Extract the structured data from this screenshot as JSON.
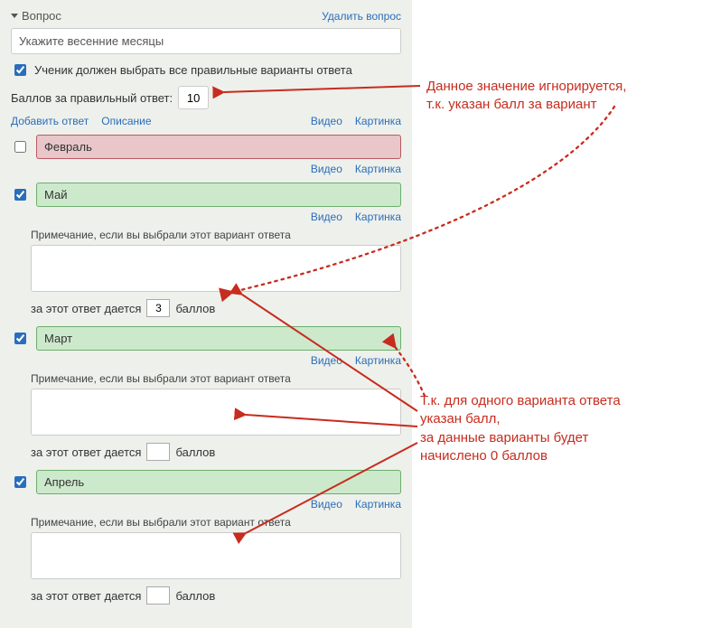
{
  "header": {
    "question_label": "Вопрос",
    "delete_label": "Удалить вопрос"
  },
  "question_text": "Укажите весенние месяцы",
  "require_all_label": "Ученик должен выбрать все правильные варианты ответа",
  "points_label": "Баллов за правильный ответ:",
  "points_value": "10",
  "add_links": {
    "add_answer": "Добавить ответ",
    "description": "Описание",
    "video": "Видео",
    "image": "Картинка"
  },
  "answer_links": {
    "video": "Видео",
    "image": "Картинка"
  },
  "note_label": "Примечание, если вы выбрали этот вариант ответа",
  "score_prefix": "за этот ответ дается",
  "score_suffix": "баллов",
  "answers": [
    {
      "text": "Февраль",
      "checked": false,
      "correct": false,
      "score": ""
    },
    {
      "text": "Май",
      "checked": true,
      "correct": true,
      "score": "3"
    },
    {
      "text": "Март",
      "checked": true,
      "correct": true,
      "score": ""
    },
    {
      "text": "Апрель",
      "checked": true,
      "correct": true,
      "score": ""
    }
  ],
  "annotations": {
    "top": "Данное значение игнорируется,\nт.к. указан балл за вариант",
    "bottom": "Т.к. для одного варианта ответа\nуказан балл,\nза данные варианты будет\nначислено 0 баллов"
  }
}
